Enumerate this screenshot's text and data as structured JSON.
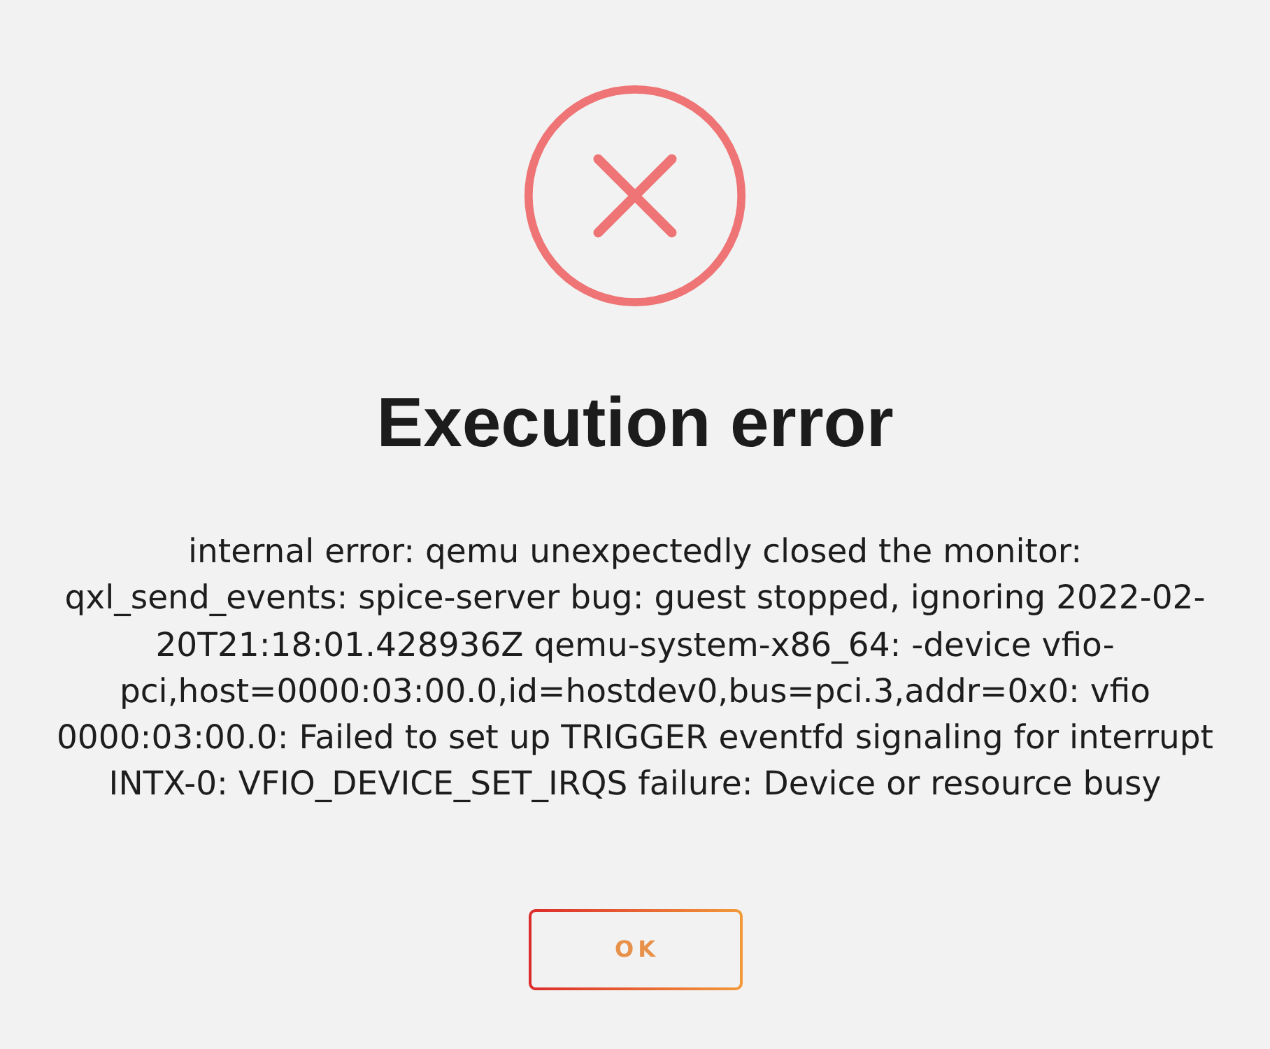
{
  "dialog": {
    "title": "Execution error",
    "message": "internal error: qemu unexpectedly closed the monitor: qxl_send_events: spice-server bug: guest stopped, ignoring 2022-02-20T21:18:01.428936Z qemu-system-x86_64: -device vfio-pci,host=0000:03:00.0,id=hostdev0,bus=pci.3,addr=0x0: vfio 0000:03:00.0: Failed to set up TRIGGER eventfd signaling for interrupt INTX-0: VFIO_DEVICE_SET_IRQS failure: Device or resource busy",
    "buttons": [
      "OK"
    ]
  }
}
